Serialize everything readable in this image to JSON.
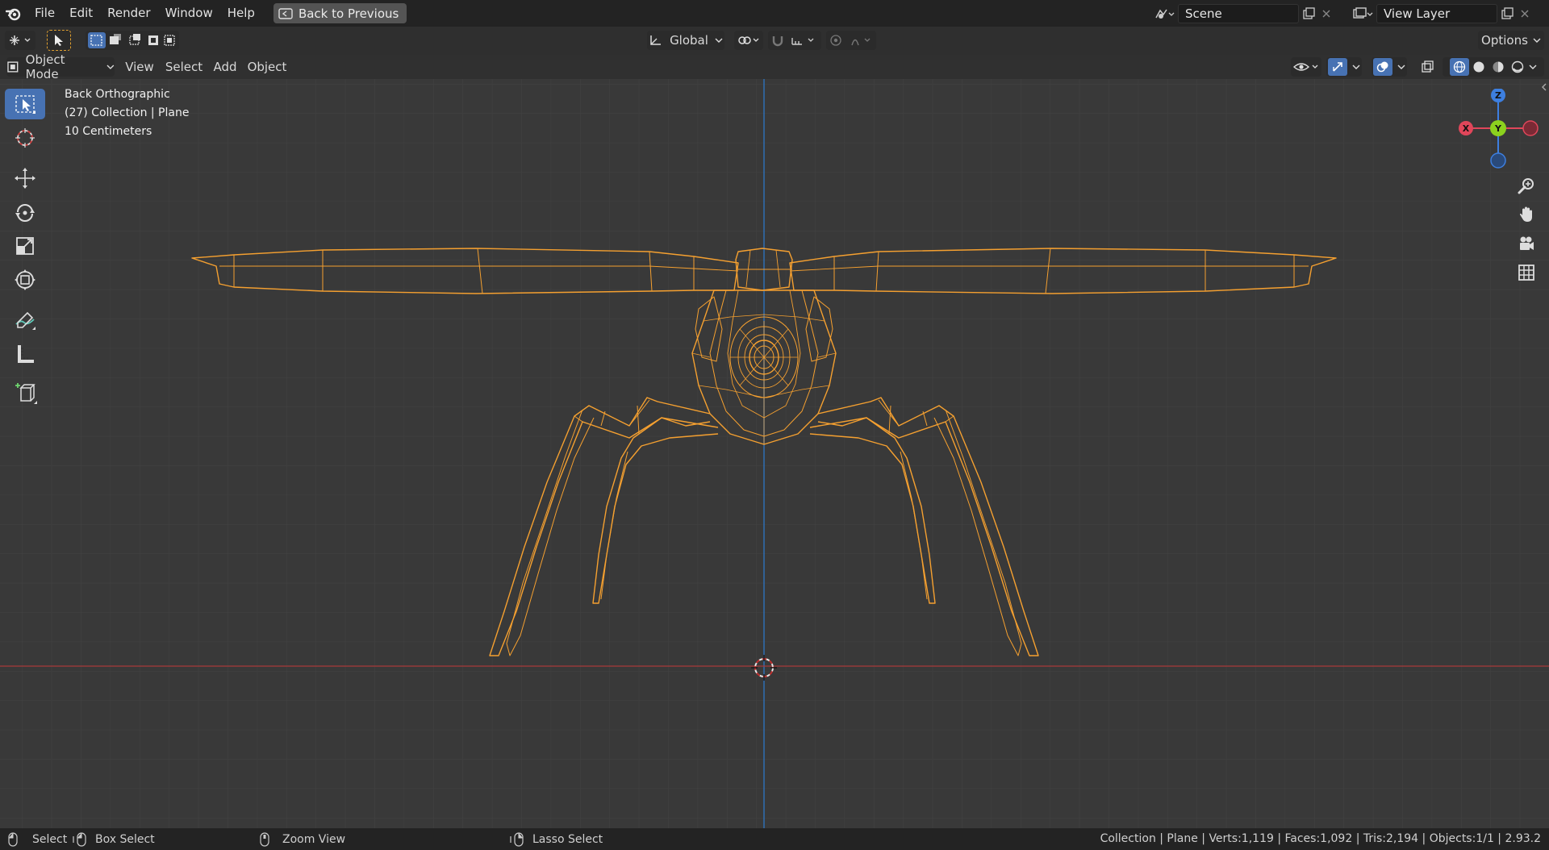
{
  "menu": {
    "items": [
      "File",
      "Edit",
      "Render",
      "Window",
      "Help"
    ],
    "back_button": "Back to Previous"
  },
  "scene": {
    "name": "Scene",
    "view_layer": "View Layer"
  },
  "tool_header": {
    "transform_orientation": "Global",
    "options_label": "Options"
  },
  "view_header": {
    "mode": "Object Mode",
    "menus": [
      "View",
      "Select",
      "Add",
      "Object"
    ]
  },
  "viewport": {
    "view_name": "Back Orthographic",
    "collection_info": "(27) Collection | Plane",
    "grid_scale": "10 Centimeters",
    "gizmo": {
      "z": "Z",
      "y": "Y",
      "x": "X"
    }
  },
  "colors": {
    "accent_blue": "#4772b3",
    "wire_orange": "#f5a030",
    "axis_x": "#e0465a",
    "axis_y": "#8cd21e",
    "axis_z": "#3d7fe0"
  },
  "status": {
    "select": "Select",
    "box_select": "Box Select",
    "zoom_view": "Zoom View",
    "lasso_select": "Lasso Select",
    "stats": "Collection | Plane | Verts:1,119 | Faces:1,092 | Tris:2,194 | Objects:1/1 | 2.93.2"
  }
}
